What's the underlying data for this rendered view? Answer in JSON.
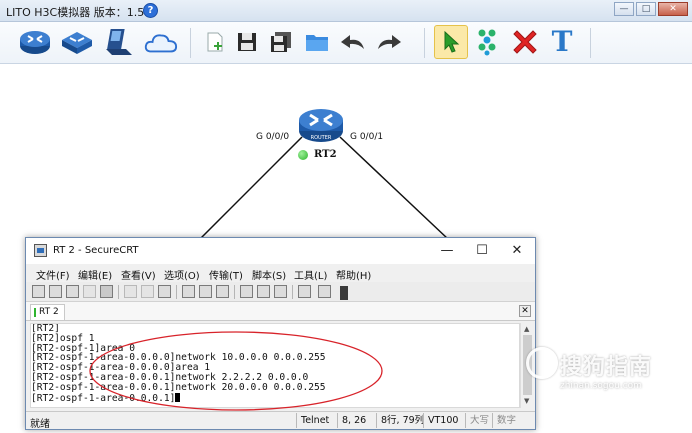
{
  "app": {
    "title": "LITO H3C模拟器 版本：1.5.2",
    "version_badge": "?",
    "controls": {
      "minimize": "—",
      "maximize": "□",
      "close": "✕"
    }
  },
  "toolbar": {
    "buttons": [
      {
        "name": "router-icon"
      },
      {
        "name": "switch-icon"
      },
      {
        "name": "pc-icon"
      },
      {
        "name": "cloud-icon"
      },
      {
        "name": "new-file-icon"
      },
      {
        "name": "save-icon"
      },
      {
        "name": "save-as-icon"
      },
      {
        "name": "open-folder-icon"
      },
      {
        "name": "undo-icon"
      },
      {
        "name": "redo-icon"
      },
      {
        "name": "pointer-icon"
      },
      {
        "name": "connect-icon"
      },
      {
        "name": "delete-icon"
      },
      {
        "name": "text-icon"
      }
    ],
    "active": "pointer-icon",
    "text_tool_glyph": "T",
    "router_badge": "ROUTER",
    "colors": {
      "device": "#1e5aa8",
      "select_active": "#fbe9a8",
      "connect": "#2bb36b",
      "delete": "#e02424",
      "text": "#2a78c8"
    }
  },
  "topology": {
    "router": {
      "name": "RT2",
      "icon": "router-icon",
      "badge": "ROUTER",
      "status": "running",
      "status_color": "#2bb32b"
    },
    "ports": {
      "left": "G 0/0/0",
      "right": "G 0/0/1"
    }
  },
  "crt": {
    "title": "RT 2 - SecureCRT",
    "controls": {
      "minimize": "—",
      "maximize": "☐",
      "close": "✕"
    },
    "menu": [
      "文件(F)",
      "编辑(E)",
      "查看(V)",
      "选项(O)",
      "传输(T)",
      "脚本(S)",
      "工具(L)",
      "帮助(H)"
    ],
    "session_tab": "RT 2",
    "tab_close": "✕",
    "terminal_lines": [
      "[RT2]",
      "[RT2]ospf 1",
      "[RT2-ospf-1]area 0",
      "[RT2-ospf-1-area-0.0.0.0]network 10.0.0.0 0.0.0.255",
      "[RT2-ospf-1-area-0.0.0.0]area 1",
      "[RT2-ospf-1-area-0.0.0.1]network 2.2.2.2 0.0.0.0",
      "[RT2-ospf-1-area-0.0.0.1]network 20.0.0.0 0.0.0.255",
      "[RT2-ospf-1-area-0.0.0.1]"
    ],
    "annotation_color": "#d8232a",
    "scroll": {
      "up": "▲",
      "down": "▼"
    },
    "status": {
      "ready": "就绪",
      "protocol": "Telnet",
      "cursor_pos": "8,  26",
      "rows_cols": "8行, 79列",
      "emulation": "VT100",
      "caps": "大写",
      "num": "数字"
    }
  },
  "watermark": {
    "text": "搜狗指南",
    "url": "zhinan.sogou.com"
  }
}
